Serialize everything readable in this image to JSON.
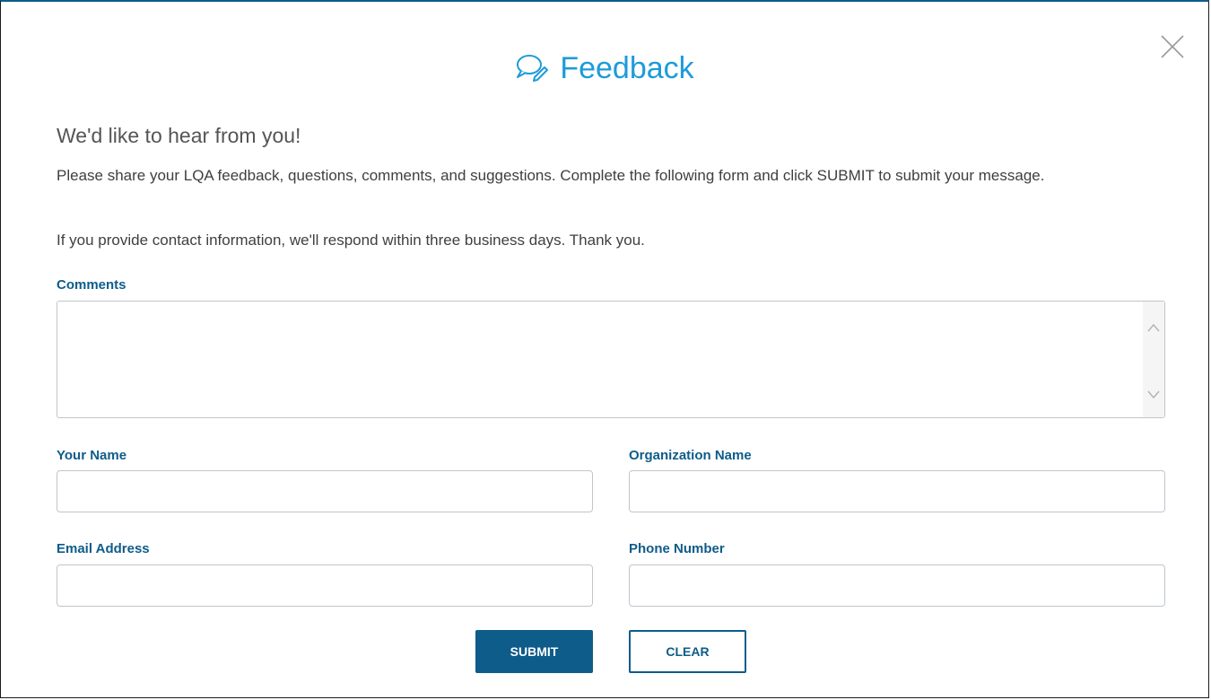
{
  "dialog": {
    "title": "Feedback",
    "title_icon": "chat-bubble-pen-icon",
    "close_icon": "close-icon",
    "accent_color": "#1d9bd9",
    "primary_color": "#0e5c8a"
  },
  "intro": {
    "heading": "We'd like to hear from you!",
    "paragraph_1": "Please share your LQA feedback, questions, comments, and suggestions. Complete the following form and click SUBMIT to submit your message.",
    "paragraph_2": "If you provide contact information, we'll respond within three business days. Thank you."
  },
  "form": {
    "comments": {
      "label": "Comments",
      "value": ""
    },
    "your_name": {
      "label": "Your Name",
      "value": ""
    },
    "organization_name": {
      "label": "Organization Name",
      "value": ""
    },
    "email_address": {
      "label": "Email Address",
      "value": ""
    },
    "phone_number": {
      "label": "Phone Number",
      "value": ""
    }
  },
  "actions": {
    "submit_label": "SUBMIT",
    "clear_label": "CLEAR"
  }
}
